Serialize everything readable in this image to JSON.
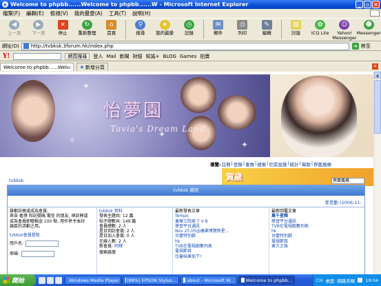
{
  "window": {
    "title": "Welcome to phpbb......Welcome to phpbb......W - Microsoft Internet Explorer"
  },
  "menu": [
    "檔案(F)",
    "編輯(E)",
    "檢視(V)",
    "我的最愛(A)",
    "工具(T)",
    "說明(H)"
  ],
  "toolbar": [
    {
      "label": "上一頁",
      "icon": "back-icon"
    },
    {
      "label": "下一頁",
      "icon": "forward-icon"
    },
    {
      "label": "停止",
      "icon": "stop-icon"
    },
    {
      "label": "重新整理",
      "icon": "refresh-icon"
    },
    {
      "label": "首頁",
      "icon": "home-icon"
    },
    {
      "label": "搜尋",
      "icon": "search-icon"
    },
    {
      "label": "我的最愛",
      "icon": "favorites-icon"
    },
    {
      "label": "記錄",
      "icon": "history-icon"
    },
    {
      "label": "郵件",
      "icon": "mail-icon"
    },
    {
      "label": "列印",
      "icon": "print-icon"
    },
    {
      "label": "編輯",
      "icon": "edit-icon"
    },
    {
      "label": "討論",
      "icon": "discuss-icon"
    },
    {
      "label": "ICQ Lite",
      "icon": "icq-icon"
    },
    {
      "label": "Yahoo! Messenger",
      "icon": "yahoo-messenger-icon"
    },
    {
      "label": "Messenger",
      "icon": "messenger-icon"
    }
  ],
  "address": {
    "label": "網址(D)",
    "url": "http://tvbksk.3forum.hk/index.php",
    "go": "移至"
  },
  "yahoo_toolbar": [
    "網頁搜尋",
    "登入",
    "Mail",
    "新聞",
    "財經",
    "知識+",
    "BLOG",
    "Games",
    "拍賣"
  ],
  "tabs": [
    {
      "label": "Welcome to phpbb......Welcome t..."
    }
  ],
  "new_tab": "新增分頁",
  "banner": {
    "title": "怡夢園",
    "subtitle": "Tavia's Dream Land"
  },
  "navlinks": {
    "prefix": "導覽:",
    "items": [
      "註冊",
      "登錄",
      "會員",
      "搜索",
      "社區設施",
      "統計",
      "幫助",
      "界面風格"
    ]
  },
  "ad": {
    "text": "賀歲",
    "select": "界面風格"
  },
  "breadcrumb": "tvbksk",
  "forum": {
    "header": "tvbksk 資訊",
    "user": "李克勤 (2006-11-",
    "col1": {
      "welcome": [
        "誰都註冊或成為會員:",
        "來自 香港 和記號碼 電信 的朋友, 現註冊或",
        "成為會員即贈積金 100 點, 用作參予本討",
        "論區的活動之用。"
      ],
      "login_title": "tvbksk會員登陸",
      "username": "用戶名:",
      "password": "密碼:"
    },
    "col2": {
      "title": "tvbksk 資料",
      "lines": [
        "發表主題共: 12 篇",
        "帖子總數共: 149 篇",
        "會員總數: 2 人",
        "是日到訪會員: 2 人",
        "是日加入會員: 0 人",
        "在線人數: 2 人"
      ],
      "newest_label": "新會員:",
      "newest": "阿輝",
      "search": "搜索論壇"
    },
    "col3": {
      "title": "最新發表文章",
      "items": [
        "Tempo",
        "東華三院與 T V B",
        "學習平台通訊",
        "Nov 25,05@康樂博覽新星...",
        "台慶特別獻",
        "hk",
        "TVB在電視劇集列表",
        "電視節目",
        "比審結果如下!"
      ]
    },
    "col4": {
      "title": "最新回覆文章",
      "items": [
        "萬千星輝",
        "學習平台通訊",
        "TVB在電視劇集列表",
        "hk",
        "台慶特別獻",
        "電視節目",
        "東方之珠"
      ]
    }
  },
  "taskbar": {
    "start": "開始",
    "tasks": [
      "Windows Media Player",
      "(88%) EPSON Stylus...",
      "about - Microsoft W...",
      "Welcome to phpbb..."
    ],
    "tray": [
      "CH",
      "桌面",
      "網路芳鄰"
    ],
    "clock": "19:04"
  }
}
